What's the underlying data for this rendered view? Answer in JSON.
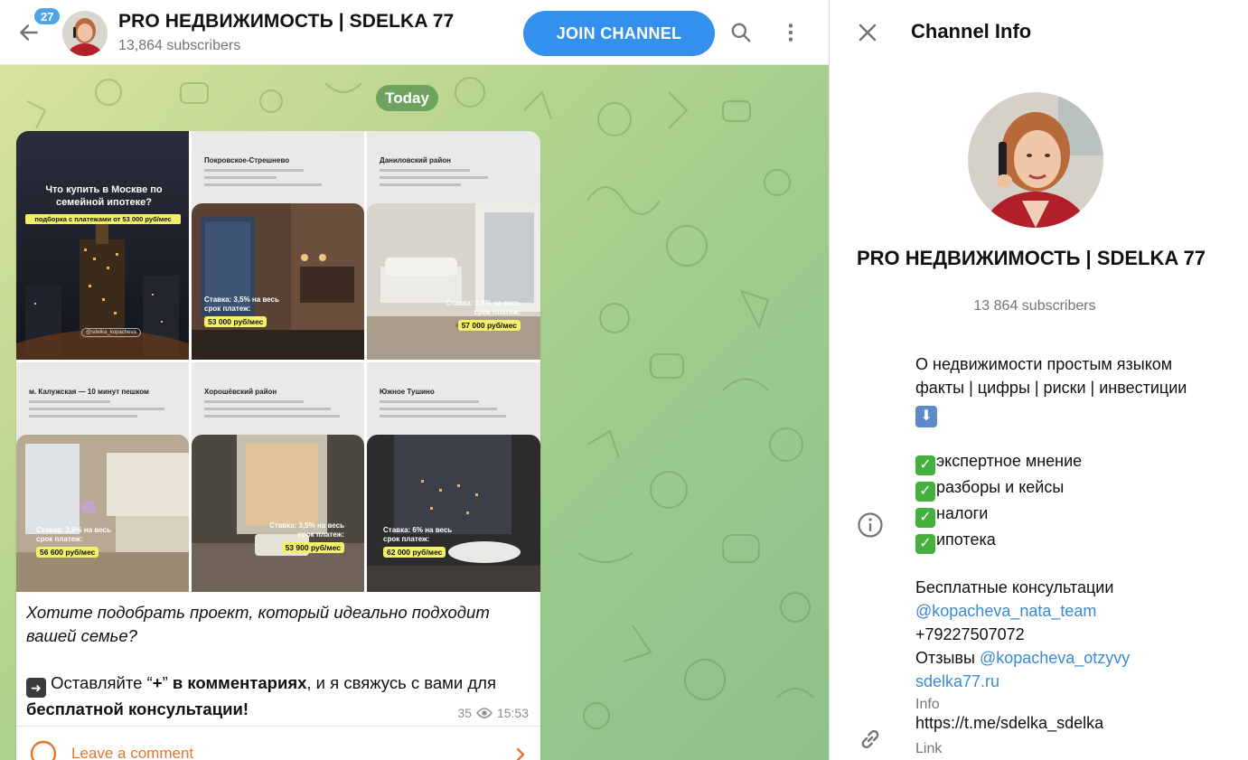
{
  "header": {
    "unread_count": "27",
    "channel_name": "PRO НЕДВИЖИМОСТЬ | SDELKA 77",
    "subscribers": "13,864 subscribers",
    "join_label": "JOIN CHANNEL"
  },
  "chat": {
    "date_chip": "Today",
    "tiles": [
      {
        "heading": "Что купить в Москве по семейной ипотеке?",
        "caption": "подборка с платежами от 53 000 руб/мес",
        "handle": "@sdelka_kopacheva"
      },
      {
        "heading": "Покровское-Стрешнево",
        "rate": "Ставка: 3,5% на весь срок платеж:",
        "price": "53 000 руб/мес"
      },
      {
        "heading": "Даниловский район",
        "rate": "Ставка: 3,9% на весь срок платеж:",
        "price": "57 000 руб/мес"
      },
      {
        "heading": "м. Калужская — 10 минут пешком",
        "rate": "Ставка: 3,9% на весь срок платеж:",
        "price": "56 600 руб/мес"
      },
      {
        "heading": "Хорошёвский район",
        "rate": "Ставка: 3,5% на весь срок платеж:",
        "price": "53 900 руб/мес"
      },
      {
        "heading": "Южное Тушино",
        "rate": "Ставка: 6% на весь срок платеж:",
        "price": "62 000 руб/мес"
      }
    ],
    "message": {
      "line1": "Хотите подобрать проект, который идеально подходит",
      "line2": "вашей семье?",
      "line3_a": "Оставляйте “",
      "line3_plus": "+",
      "line3_b": "” ",
      "line3_bold": "в комментариях",
      "line3_c": ", и я свяжусь с вами для",
      "line4": "бесплатной консультации!",
      "views": "35",
      "time": "15:53"
    },
    "comment_label": "Leave a comment"
  },
  "info": {
    "title": "Channel Info",
    "name": "PRO НЕДВИЖИМОСТЬ | SDELKA 77",
    "subscribers": "13 864 subscribers",
    "desc_l1": "О недвижимости простым языком",
    "desc_l2": "факты | цифры | риски | инвестиции",
    "bullets": [
      "экспертное мнение",
      "разборы и кейсы",
      "налоги",
      "ипотека"
    ],
    "consult": "Бесплатные консультации",
    "team_link": "@kopacheva_nata_team",
    "phone": "+79227507072",
    "reviews_label": "Отзывы ",
    "reviews_link": "@kopacheva_otzyvy",
    "site_link": "sdelka77.ru",
    "info_label": "Info",
    "tme_link": "https://t.me/sdelka_sdelka",
    "link_label": "Link"
  },
  "colors": {
    "accent": "#3390ec",
    "comment": "#e4762c",
    "link": "#3a8ad3",
    "date_chip": "#6fa35d"
  },
  "icons": [
    "back-arrow-icon",
    "search-icon",
    "more-vertical-icon",
    "eye-icon",
    "comment-circle-icon",
    "chevron-right-icon",
    "close-icon",
    "info-icon",
    "link-icon",
    "check-mark-icon",
    "down-arrow-icon",
    "right-arrow-icon"
  ]
}
